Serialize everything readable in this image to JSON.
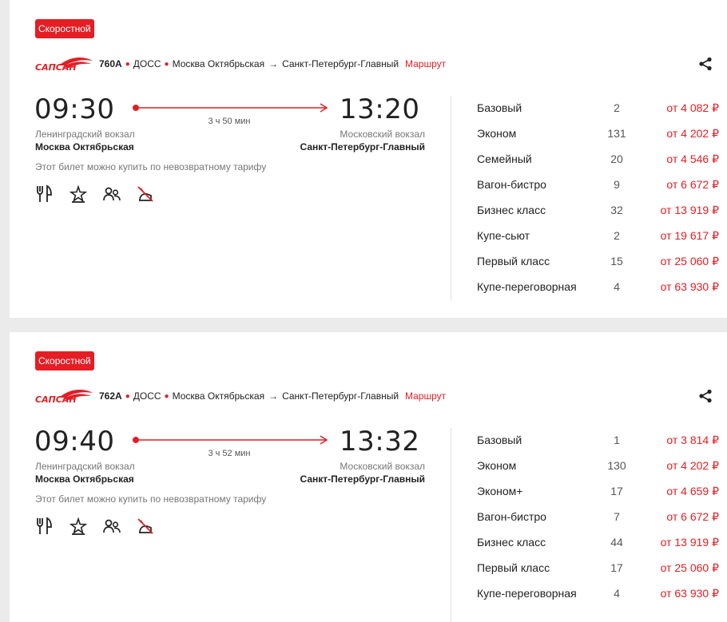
{
  "colors": {
    "accent": "#e31e24",
    "background": "#ebebeb"
  },
  "trains": [
    {
      "badge": "Скоростной",
      "number": "760А",
      "carrier": "ДОСС",
      "route_from": "Москва Октябрьская",
      "route_arrow": "→",
      "route_to": "Санкт-Петербург-Главный",
      "route_link": "Маршрут",
      "dep_time": "09:30",
      "arr_time": "13:20",
      "duration": "3 ч 50 мин",
      "dep_station": "Ленинградский вокзал",
      "dep_city": "Москва Октябрьская",
      "arr_station": "Московский вокзал",
      "arr_city": "Санкт-Петербург-Главный",
      "tariff_note": "Этот билет можно купить по невозвратному тарифу",
      "amenities": [
        "restaurant-icon",
        "star-icon",
        "people-icon",
        "no-pets-icon"
      ],
      "classes": [
        {
          "name": "Базовый",
          "seats": "2",
          "price": "от 4 082 ₽"
        },
        {
          "name": "Эконом",
          "seats": "131",
          "price": "от 4 202 ₽"
        },
        {
          "name": "Семейный",
          "seats": "20",
          "price": "от 4 546 ₽"
        },
        {
          "name": "Вагон-бистро",
          "seats": "9",
          "price": "от 6 672 ₽"
        },
        {
          "name": "Бизнес класс",
          "seats": "32",
          "price": "от 13 919 ₽"
        },
        {
          "name": "Купе-сьют",
          "seats": "2",
          "price": "от 19 617 ₽"
        },
        {
          "name": "Первый класс",
          "seats": "15",
          "price": "от 25 060 ₽"
        },
        {
          "name": "Купе-переговорная",
          "seats": "4",
          "price": "от 63 930 ₽"
        }
      ]
    },
    {
      "badge": "Скоростной",
      "number": "762А",
      "carrier": "ДОСС",
      "route_from": "Москва Октябрьская",
      "route_arrow": "→",
      "route_to": "Санкт-Петербург-Главный",
      "route_link": "Маршрут",
      "dep_time": "09:40",
      "arr_time": "13:32",
      "duration": "3 ч 52 мин",
      "dep_station": "Ленинградский вокзал",
      "dep_city": "Москва Октябрьская",
      "arr_station": "Московский вокзал",
      "arr_city": "Санкт-Петербург-Главный",
      "tariff_note": "Этот билет можно купить по невозвратному тарифу",
      "amenities": [
        "restaurant-icon",
        "star-icon",
        "people-icon",
        "no-pets-icon"
      ],
      "classes": [
        {
          "name": "Базовый",
          "seats": "1",
          "price": "от 3 814 ₽"
        },
        {
          "name": "Эконом",
          "seats": "130",
          "price": "от 4 202 ₽"
        },
        {
          "name": "Эконом+",
          "seats": "17",
          "price": "от 4 659 ₽"
        },
        {
          "name": "Вагон-бистро",
          "seats": "7",
          "price": "от 6 672 ₽"
        },
        {
          "name": "Бизнес класс",
          "seats": "44",
          "price": "от 13 919 ₽"
        },
        {
          "name": "Первый класс",
          "seats": "17",
          "price": "от 25 060 ₽"
        },
        {
          "name": "Купе-переговорная",
          "seats": "4",
          "price": "от 63 930 ₽"
        }
      ]
    }
  ]
}
